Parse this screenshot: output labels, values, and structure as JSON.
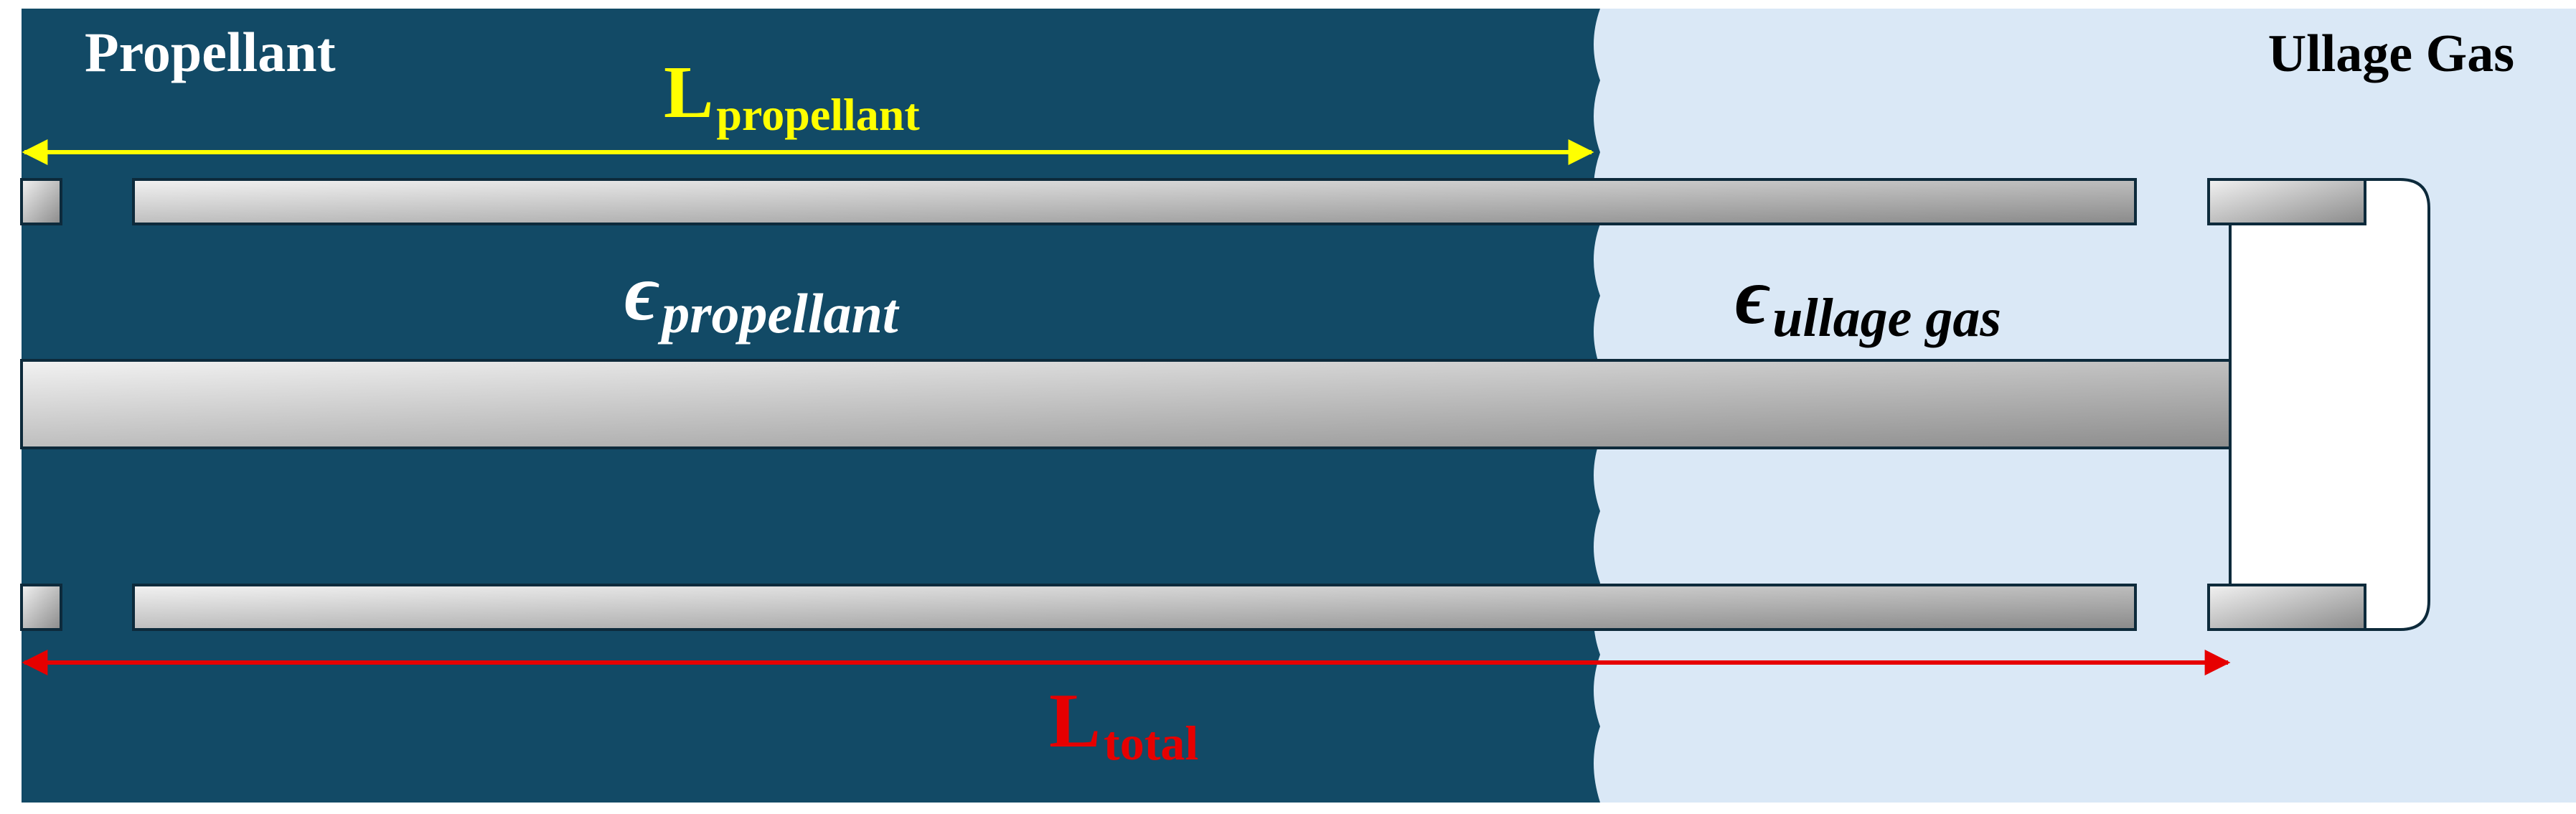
{
  "labels": {
    "propellant": "Propellant",
    "ullage_gas": "Ullage Gas",
    "l_propellant": {
      "main": "L",
      "sub": "propellant"
    },
    "l_total": {
      "main": "L",
      "sub": "total"
    },
    "eps_propellant": {
      "symbol": "ϵ",
      "sub": "propellant"
    },
    "eps_ullage": {
      "symbol": "ϵ",
      "sub": "ullage gas"
    }
  },
  "colors": {
    "propellant_region": "#124a66",
    "ullage_region": "#dae8f6",
    "tube_outline": "#0d2a3b",
    "tube_light": "#f2f2f2",
    "tube_dark": "#8a8a8a",
    "l_propellant_arrow": "#ffff00",
    "l_total_arrow": "#e60000",
    "white_text": "#ffffff",
    "black_text": "#000000"
  }
}
